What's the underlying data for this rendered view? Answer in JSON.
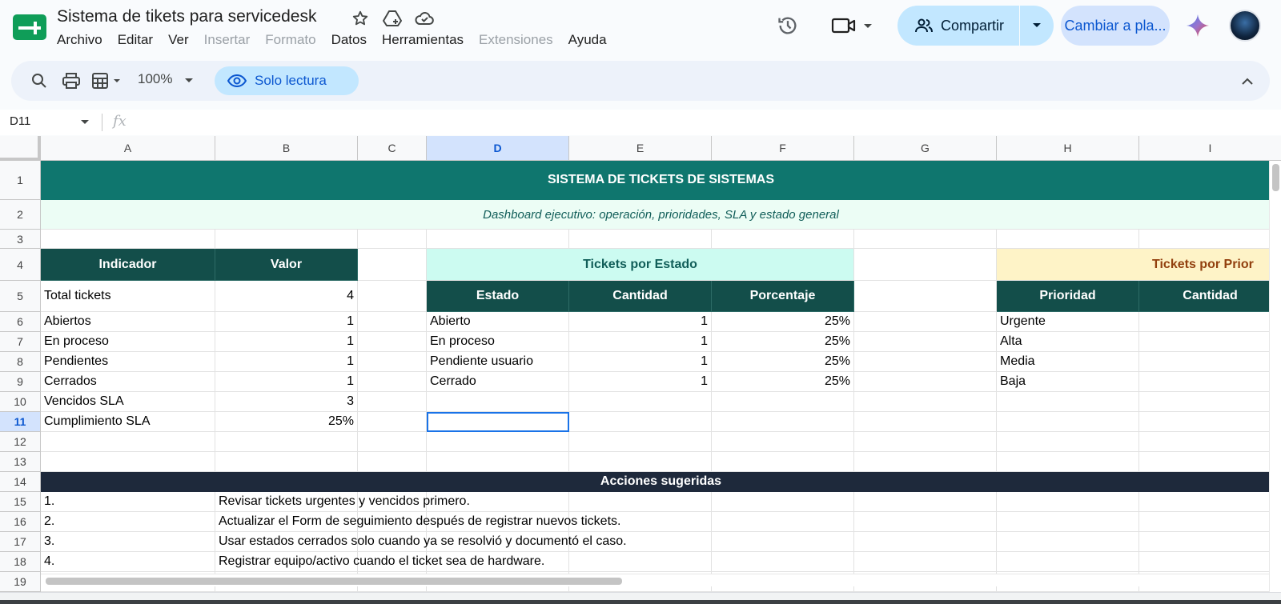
{
  "app": {
    "doc_title": "Sistema de tikets para servicedesk",
    "menu": [
      {
        "label": "Archivo",
        "enabled": true
      },
      {
        "label": "Editar",
        "enabled": true
      },
      {
        "label": "Ver",
        "enabled": true
      },
      {
        "label": "Insertar",
        "enabled": false
      },
      {
        "label": "Formato",
        "enabled": false
      },
      {
        "label": "Datos",
        "enabled": true
      },
      {
        "label": "Herramientas",
        "enabled": true
      },
      {
        "label": "Extensiones",
        "enabled": false
      },
      {
        "label": "Ayuda",
        "enabled": true
      }
    ],
    "share_label": "Compartir",
    "switch_label": "Cambiar a pla...",
    "accent_color": "#0f766e"
  },
  "toolbar": {
    "zoom": "100%",
    "readonly_label": "Solo lectura"
  },
  "formula": {
    "cell_ref": "D11",
    "fx": "fx"
  },
  "grid": {
    "columns": [
      "A",
      "B",
      "C",
      "D",
      "E",
      "F",
      "G",
      "H",
      "I"
    ],
    "selected_column": "D",
    "rows": [
      "1",
      "2",
      "3",
      "4",
      "5",
      "6",
      "7",
      "8",
      "9",
      "10",
      "11",
      "12",
      "13",
      "14",
      "15",
      "16",
      "17",
      "18",
      "19"
    ],
    "selected_row": "11"
  },
  "sheet": {
    "title": "SISTEMA DE TICKETS DE SISTEMAS",
    "subtitle": "Dashboard ejecutivo: operación, prioridades, SLA y estado general",
    "kpi": {
      "header_indicator": "Indicador",
      "header_value": "Valor",
      "rows": [
        {
          "label": "Total tickets",
          "value": "4"
        },
        {
          "label": "Abiertos",
          "value": "1"
        },
        {
          "label": "En proceso",
          "value": "1"
        },
        {
          "label": "Pendientes",
          "value": "1"
        },
        {
          "label": "Cerrados",
          "value": "1"
        },
        {
          "label": "Vencidos SLA",
          "value": "3"
        },
        {
          "label": "Cumplimiento SLA",
          "value": "25%"
        }
      ]
    },
    "by_status": {
      "title": "Tickets por Estado",
      "headers": [
        "Estado",
        "Cantidad",
        "Porcentaje"
      ],
      "rows": [
        {
          "estado": "Abierto",
          "cantidad": "1",
          "porcentaje": "25%"
        },
        {
          "estado": "En proceso",
          "cantidad": "1",
          "porcentaje": "25%"
        },
        {
          "estado": "Pendiente usuario",
          "cantidad": "1",
          "porcentaje": "25%"
        },
        {
          "estado": "Cerrado",
          "cantidad": "1",
          "porcentaje": "25%"
        }
      ]
    },
    "by_priority": {
      "title": "Tickets por Prior",
      "headers": [
        "Prioridad",
        "Cantidad"
      ],
      "rows": [
        "Urgente",
        "Alta",
        "Media",
        "Baja"
      ]
    },
    "actions": {
      "title": "Acciones sugeridas",
      "items": [
        {
          "n": "1.",
          "text": "Revisar tickets urgentes y vencidos primero."
        },
        {
          "n": "2.",
          "text": "Actualizar el Form de seguimiento después de registrar nuevos tickets."
        },
        {
          "n": "3.",
          "text": "Usar estados cerrados solo cuando ya se resolvió y documentó el caso."
        },
        {
          "n": "4.",
          "text": "Registrar equipo/activo cuando el ticket sea de hardware."
        }
      ]
    }
  }
}
